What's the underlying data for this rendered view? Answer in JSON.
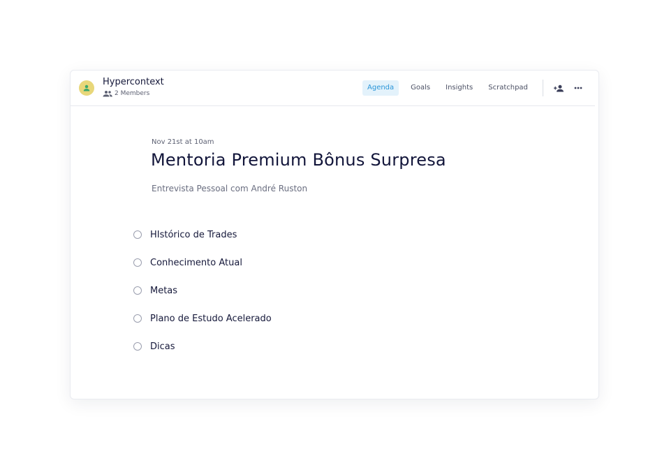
{
  "workspace": {
    "name": "Hypercontext",
    "members_label": "2 Members"
  },
  "tabs": [
    {
      "label": "Agenda",
      "active": true
    },
    {
      "label": "Goals",
      "active": false
    },
    {
      "label": "Insights",
      "active": false
    },
    {
      "label": "Scratchpad",
      "active": false
    }
  ],
  "icons": {
    "avatar": "user-icon",
    "members": "group-icon",
    "add_user": "add-user-icon",
    "more": "more-horizontal-icon"
  },
  "meeting": {
    "date": "Nov 21st at 10am",
    "title": "Mentoria Premium Bônus Surpresa",
    "subtitle": "Entrevista Pessoal com André Ruston"
  },
  "agenda_items": [
    {
      "label": "HIstórico de Trades"
    },
    {
      "label": "Conhecimento Atual"
    },
    {
      "label": "Metas"
    },
    {
      "label": "Plano de Estudo Acelerado"
    },
    {
      "label": "Dicas"
    }
  ],
  "colors": {
    "accent": "#2a95d8",
    "accent_bg": "#e3f2fb",
    "avatar_bg": "#e8d77a",
    "avatar_fg": "#3aa86b",
    "text_primary": "#12153a"
  }
}
